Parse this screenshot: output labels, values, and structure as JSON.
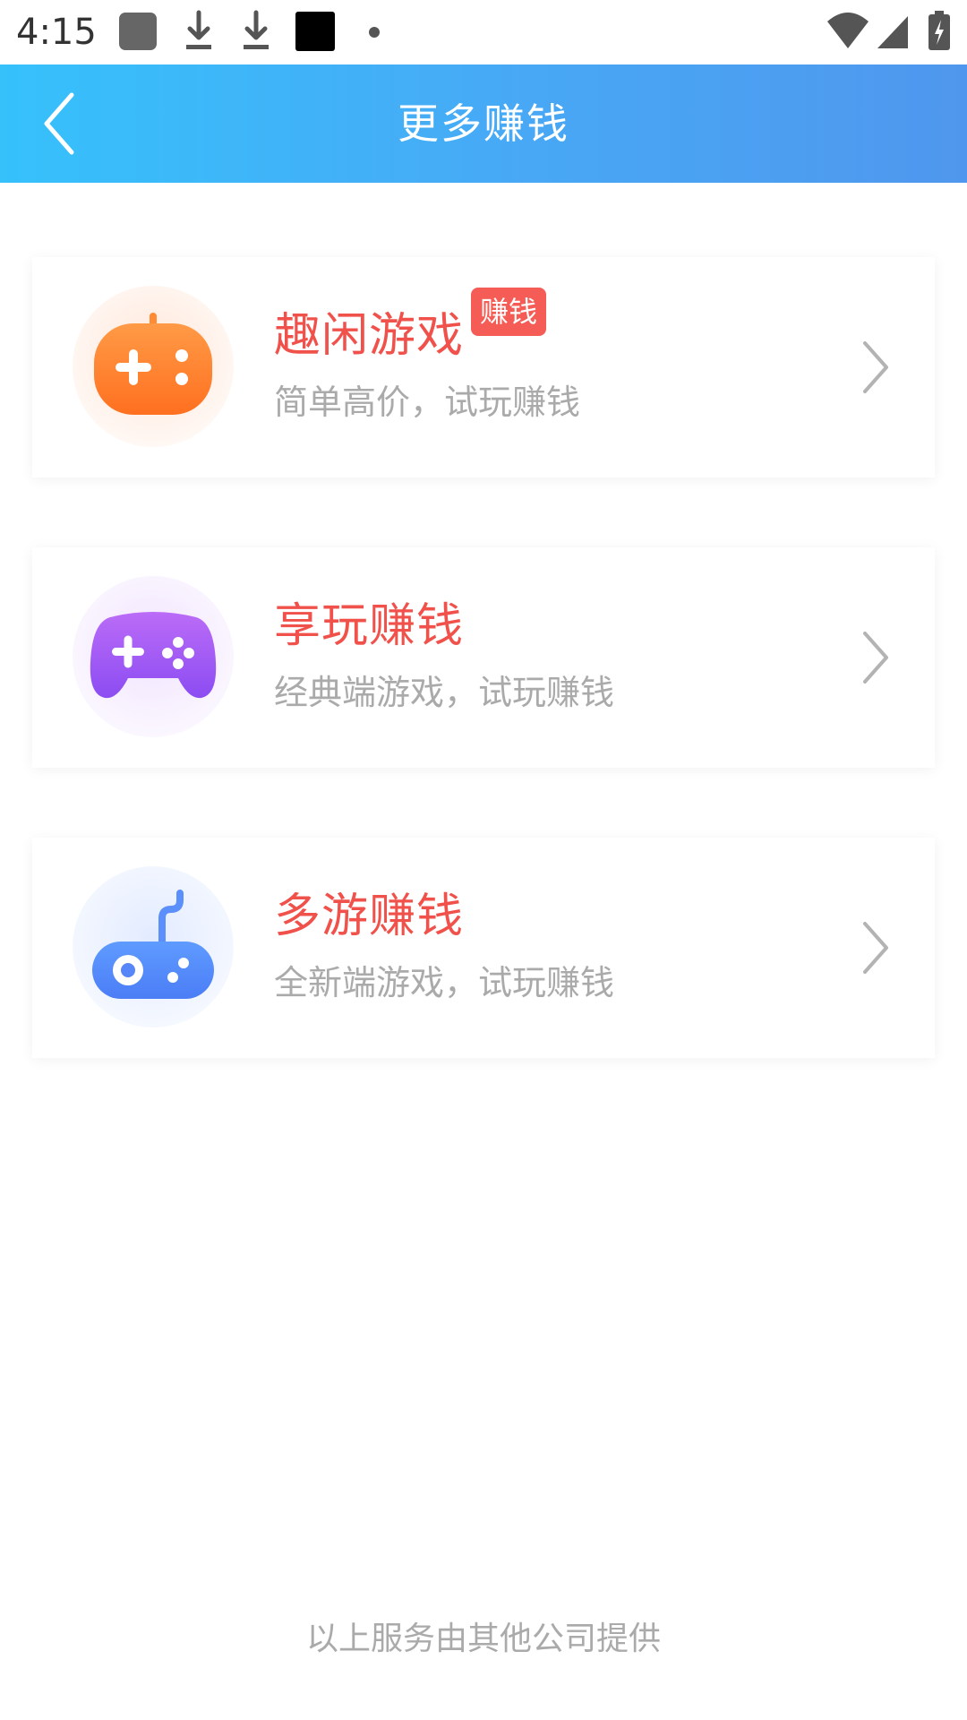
{
  "status_bar": {
    "time": "4:15",
    "icons": [
      "app-notification-icon",
      "download-icon",
      "download-icon",
      "app-notification-icon",
      "dot-icon",
      "wifi-icon",
      "cellular-signal-icon",
      "battery-charging-icon"
    ]
  },
  "app_bar": {
    "title": "更多赚钱",
    "back_icon": "chevron-left-icon"
  },
  "cards": [
    {
      "title": "趣闲游戏",
      "badge": "赚钱",
      "subtitle": "简单高价，试玩赚钱",
      "icon": "orange-gamepad-icon",
      "accent": "#ff7d2a"
    },
    {
      "title": "享玩赚钱",
      "subtitle": "经典端游戏，试玩赚钱",
      "icon": "purple-gamepad-icon",
      "accent": "#9d57f7"
    },
    {
      "title": "多游赚钱",
      "subtitle": "全新端游戏，试玩赚钱",
      "icon": "blue-gamepad-icon",
      "accent": "#4f7ff8"
    }
  ],
  "footer": {
    "note": "以上服务由其他公司提供"
  },
  "colors": {
    "app_bar_start": "#36c1fb",
    "app_bar_end": "#4f97ee",
    "title_red": "#f0524b",
    "badge_red": "#f45c55",
    "subtitle_gray": "#aaaaaa"
  }
}
